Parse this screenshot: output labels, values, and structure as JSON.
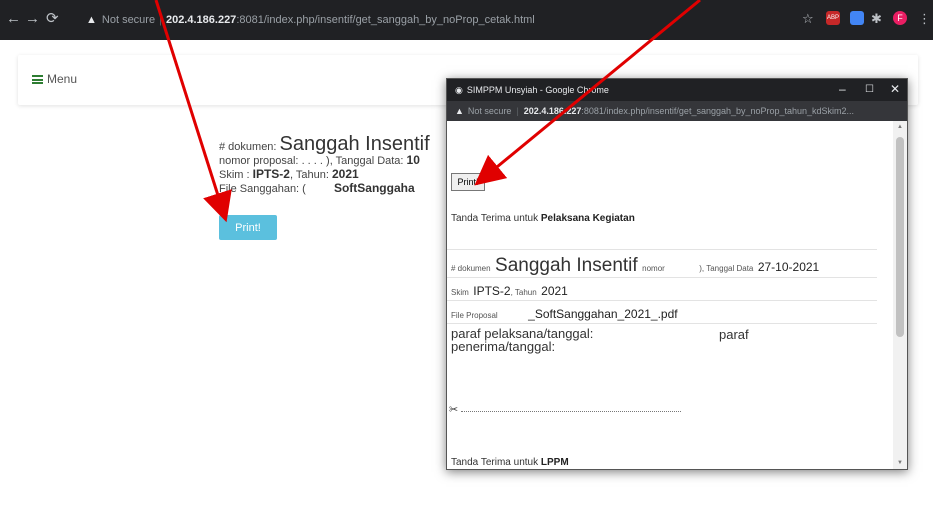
{
  "browser": {
    "security_label": "Not secure",
    "url_host": "202.4.186.227",
    "url_path": ":8081/index.php/insentif/get_sanggah_by_noProp_cetak.html",
    "profile_initial": "F",
    "ext_label": "ABP"
  },
  "menu": {
    "label": "Menu"
  },
  "document": {
    "prefix": "# dokumen:",
    "title": "Sanggah Insentif",
    "nomor_label": "nomor proposal:",
    "nomor_value": ". . . . )",
    "tanggal_label": ", Tanggal Data:",
    "tanggal_value": "10",
    "skim_label": "Skim :",
    "skim_value": "IPTS-2",
    "tahun_label": ", Tahun:",
    "tahun_value": "2021",
    "file_label": "File Sanggahan: (",
    "file_value": "SoftSanggaha",
    "print_label": "Print!"
  },
  "popup": {
    "window_title": "SIMPPM Unsyiah - Google Chrome",
    "security_label": "Not secure",
    "url_host": "202.4.186.227",
    "url_path": ":8081/index.php/insentif/get_sanggah_by_noProp_tahun_kdSkim2...",
    "print_label": "Print!",
    "receipt_prefix": "Tanda Terima untuk",
    "receipt_target": "Pelaksana Kegiatan",
    "dok_prefix": "# dokumen",
    "dok_title": "Sanggah Insentif",
    "nomor_label": "nomor",
    "tanggal_label": "), Tanggal Data",
    "tanggal_value": "27-10-2021",
    "skim_label": "Skim",
    "skim_value": "IPTS-2",
    "tahun_label": ", Tahun",
    "tahun_value": "2021",
    "file_label": "File Proposal",
    "file_value": "_SoftSanggahan_2021_.pdf",
    "sign_left": "paraf pelaksana/tanggal:",
    "sign_left_2": "penerima/tanggal:",
    "sign_right": "paraf",
    "receipt2_prefix": "Tanda Terima untuk",
    "receipt2_target": "LPPM"
  }
}
